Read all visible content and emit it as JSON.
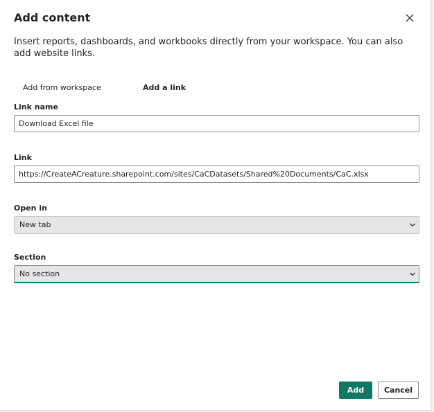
{
  "dialog": {
    "title": "Add content",
    "description": "Insert reports, dashboards, and workbooks directly from your workspace. You can also add website links.",
    "close_icon": "close-icon"
  },
  "tabs": [
    {
      "label": "Add from workspace",
      "selected": false
    },
    {
      "label": "Add a link",
      "selected": true
    }
  ],
  "form": {
    "link_name": {
      "label": "Link name",
      "value": "Download Excel file"
    },
    "link": {
      "label": "Link",
      "value": "https://CreateACreature.sharepoint.com/sites/CaCDatasets/Shared%20Documents/CaC.xlsx"
    },
    "open_in": {
      "label": "Open in",
      "value": "New tab",
      "icon": "chevron-down-icon"
    },
    "section": {
      "label": "Section",
      "value": "No section",
      "icon": "chevron-down-icon"
    }
  },
  "buttons": {
    "add": "Add",
    "cancel": "Cancel"
  },
  "colors": {
    "accent": "#117865",
    "text": "#252423",
    "select_bg": "#e6e6e6"
  }
}
